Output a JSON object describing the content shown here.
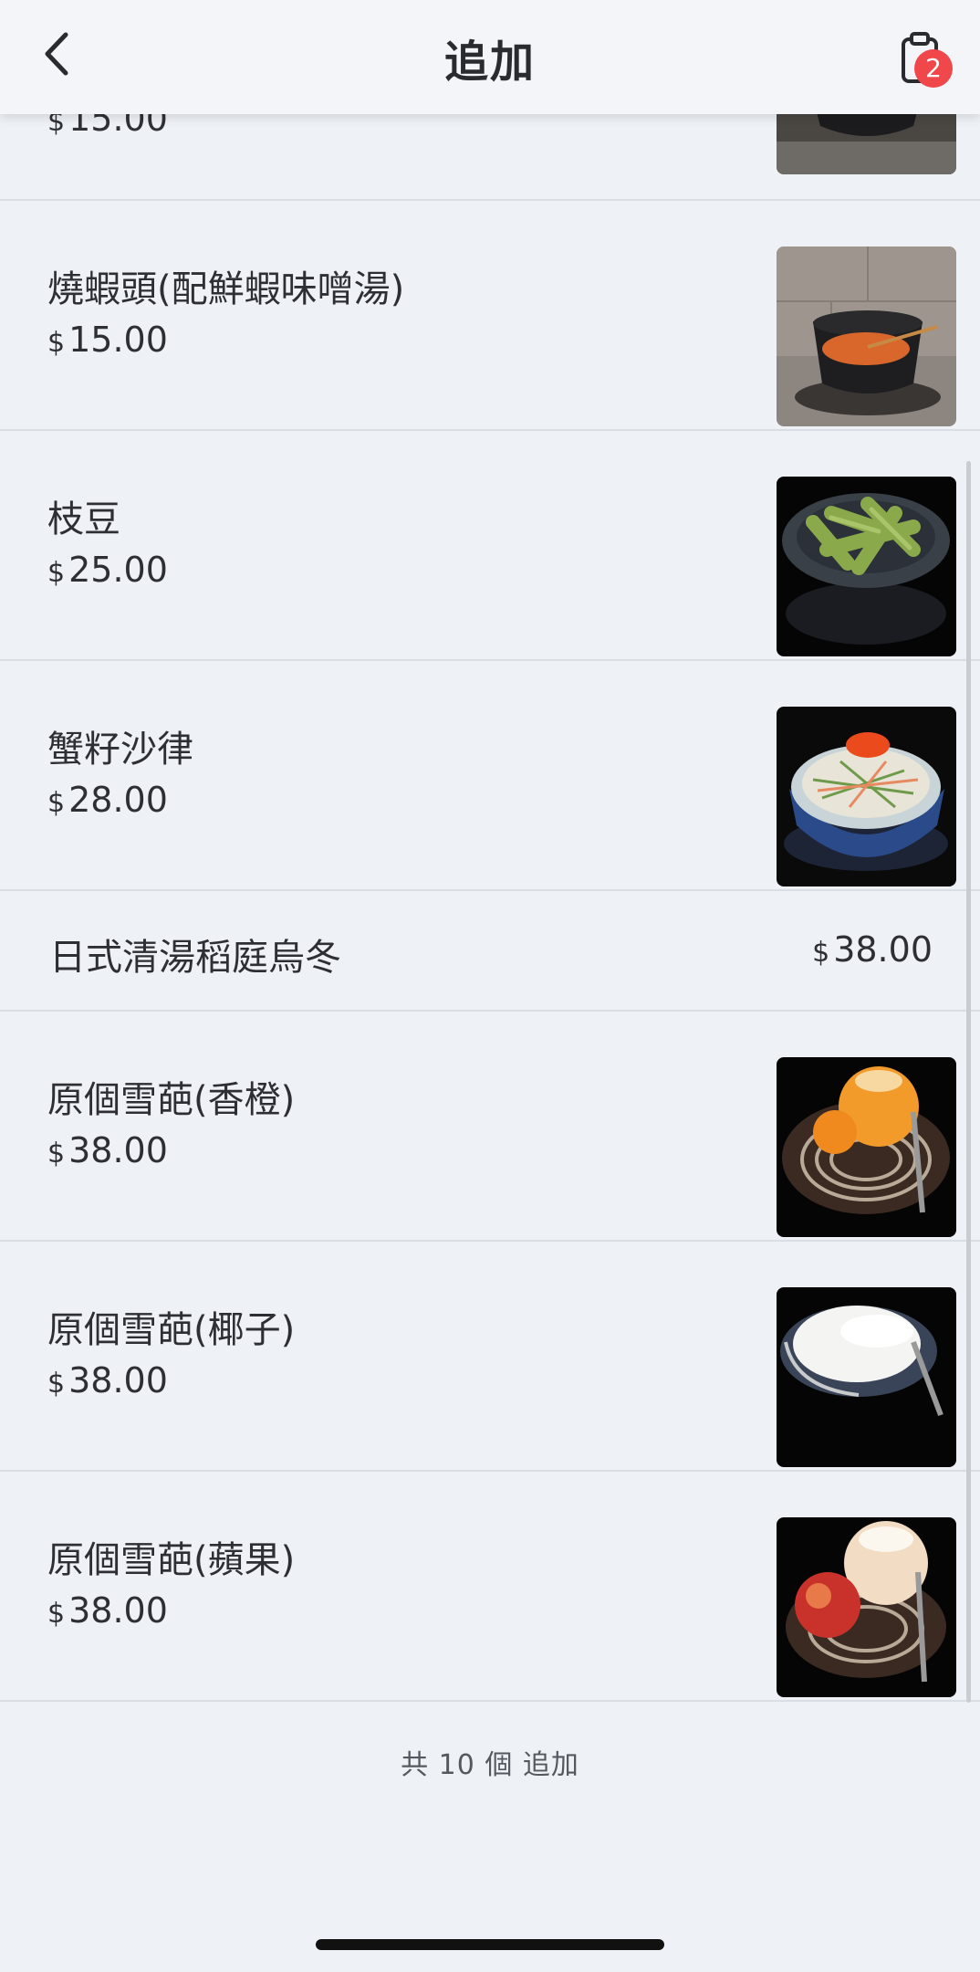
{
  "header": {
    "title": "追加",
    "back_icon": "chevron-left-icon",
    "cart_icon": "clipboard-icon",
    "cart_badge": "2",
    "badge_color": "#f0484a"
  },
  "currency": "$",
  "partial_item": {
    "price": "15.00"
  },
  "items": [
    {
      "name": "燒蝦頭(配鮮蝦味噌湯)",
      "price": "15.00",
      "image": "miso-soup-bowl"
    },
    {
      "name": "枝豆",
      "price": "25.00",
      "image": "edamame-bowl"
    },
    {
      "name": "蟹籽沙律",
      "price": "28.00",
      "image": "crab-roe-salad"
    },
    {
      "name": "日式清湯稻庭烏冬",
      "price": "38.00"
    },
    {
      "name": "原個雪葩(香橙)",
      "price": "38.00",
      "image": "orange-sorbet"
    },
    {
      "name": "原個雪葩(椰子)",
      "price": "38.00",
      "image": "coconut-sorbet"
    },
    {
      "name": "原個雪葩(蘋果)",
      "price": "38.00",
      "image": "apple-sorbet"
    }
  ],
  "footer": {
    "count_text": "共 10 個 追加"
  }
}
